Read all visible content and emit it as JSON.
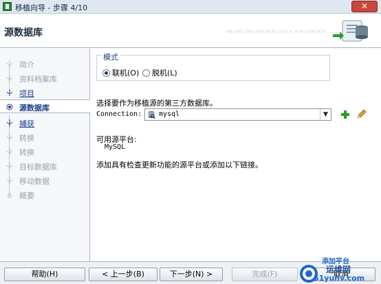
{
  "window": {
    "title": "移植向导 - 步骤 4/10",
    "close_glyph": "✕"
  },
  "header": {
    "title": "源数据库",
    "binary_text": "00100110010001010110110 01011001010"
  },
  "steps": [
    {
      "label": "简介",
      "state": "disabled"
    },
    {
      "label": "资料档案库",
      "state": "disabled"
    },
    {
      "label": "项目",
      "state": "visited"
    },
    {
      "label": "源数据库",
      "state": "current"
    },
    {
      "label": "捕获",
      "state": "visited"
    },
    {
      "label": "转换",
      "state": "disabled"
    },
    {
      "label": "转换",
      "state": "disabled"
    },
    {
      "label": "目标数据库",
      "state": "disabled"
    },
    {
      "label": "移动数据",
      "state": "disabled"
    },
    {
      "label": "概要",
      "state": "disabled"
    }
  ],
  "mode": {
    "legend": "模式",
    "online_label": "联机(O)",
    "offline_label": "脱机(L)",
    "selected": "online"
  },
  "instruction": "选择要作为移植源的第三方数据库。",
  "connection": {
    "label": "Connection:",
    "value": "mysql"
  },
  "available": {
    "label": "可用源平台:",
    "value": "MySQL"
  },
  "hint": "添加具有检查更新功能的源平台或添加以下链接。",
  "footer": {
    "help": "帮助(H)",
    "back": "< 上一步(B)",
    "next": "下一步(N) >",
    "finish": "完成(F)",
    "cancel": "取消"
  },
  "watermark": {
    "top": "运维网",
    "bottom": "51yunv.com",
    "add_platform": "添加平台"
  },
  "colors": {
    "accent": "#1c3e8a",
    "disabled": "#9aa2aa",
    "add_green": "#2b9a2e"
  }
}
